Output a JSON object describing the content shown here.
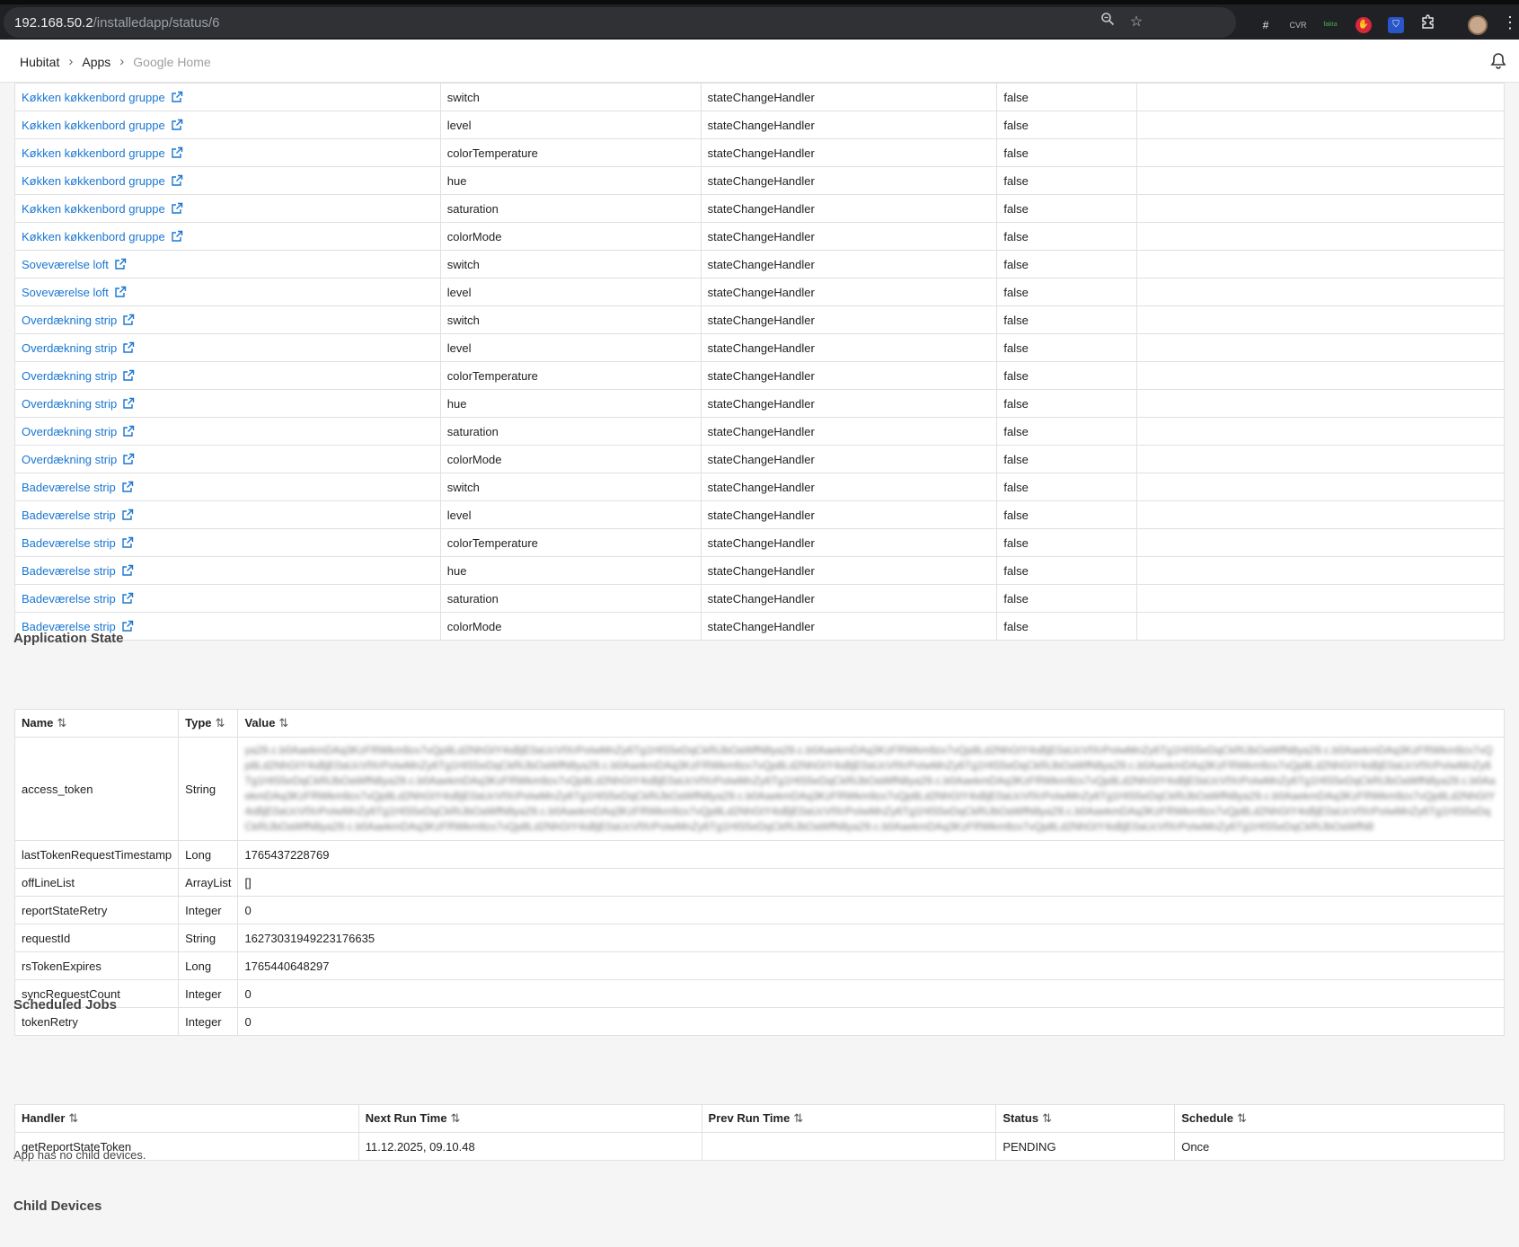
{
  "browser": {
    "url_host": "192.168.50.2",
    "url_path": "/installedapp/status/6",
    "extensions": [
      "#",
      "CVR",
      "fakta"
    ]
  },
  "breadcrumb": [
    "Hubitat",
    "Apps",
    "Google Home"
  ],
  "subscriptions": [
    {
      "device": "Køkken køkkenbord gruppe",
      "attribute": "switch",
      "handler": "stateChangeHandler",
      "filter": "false",
      "extra": ""
    },
    {
      "device": "Køkken køkkenbord gruppe",
      "attribute": "level",
      "handler": "stateChangeHandler",
      "filter": "false",
      "extra": ""
    },
    {
      "device": "Køkken køkkenbord gruppe",
      "attribute": "colorTemperature",
      "handler": "stateChangeHandler",
      "filter": "false",
      "extra": ""
    },
    {
      "device": "Køkken køkkenbord gruppe",
      "attribute": "hue",
      "handler": "stateChangeHandler",
      "filter": "false",
      "extra": ""
    },
    {
      "device": "Køkken køkkenbord gruppe",
      "attribute": "saturation",
      "handler": "stateChangeHandler",
      "filter": "false",
      "extra": ""
    },
    {
      "device": "Køkken køkkenbord gruppe",
      "attribute": "colorMode",
      "handler": "stateChangeHandler",
      "filter": "false",
      "extra": ""
    },
    {
      "device": "Soveværelse loft",
      "attribute": "switch",
      "handler": "stateChangeHandler",
      "filter": "false",
      "extra": ""
    },
    {
      "device": "Soveværelse loft",
      "attribute": "level",
      "handler": "stateChangeHandler",
      "filter": "false",
      "extra": ""
    },
    {
      "device": "Overdækning strip",
      "attribute": "switch",
      "handler": "stateChangeHandler",
      "filter": "false",
      "extra": ""
    },
    {
      "device": "Overdækning strip",
      "attribute": "level",
      "handler": "stateChangeHandler",
      "filter": "false",
      "extra": ""
    },
    {
      "device": "Overdækning strip",
      "attribute": "colorTemperature",
      "handler": "stateChangeHandler",
      "filter": "false",
      "extra": ""
    },
    {
      "device": "Overdækning strip",
      "attribute": "hue",
      "handler": "stateChangeHandler",
      "filter": "false",
      "extra": ""
    },
    {
      "device": "Overdækning strip",
      "attribute": "saturation",
      "handler": "stateChangeHandler",
      "filter": "false",
      "extra": ""
    },
    {
      "device": "Overdækning strip",
      "attribute": "colorMode",
      "handler": "stateChangeHandler",
      "filter": "false",
      "extra": ""
    },
    {
      "device": "Badeværelse strip",
      "attribute": "switch",
      "handler": "stateChangeHandler",
      "filter": "false",
      "extra": ""
    },
    {
      "device": "Badeværelse strip",
      "attribute": "level",
      "handler": "stateChangeHandler",
      "filter": "false",
      "extra": ""
    },
    {
      "device": "Badeværelse strip",
      "attribute": "colorTemperature",
      "handler": "stateChangeHandler",
      "filter": "false",
      "extra": ""
    },
    {
      "device": "Badeværelse strip",
      "attribute": "hue",
      "handler": "stateChangeHandler",
      "filter": "false",
      "extra": ""
    },
    {
      "device": "Badeværelse strip",
      "attribute": "saturation",
      "handler": "stateChangeHandler",
      "filter": "false",
      "extra": ""
    },
    {
      "device": "Badeværelse strip",
      "attribute": "colorMode",
      "handler": "stateChangeHandler",
      "filter": "false",
      "extra": ""
    }
  ],
  "app_state": {
    "title": "Application State",
    "headers": [
      "Name",
      "Type",
      "Value"
    ],
    "rows": [
      {
        "name": "access_token",
        "type": "String",
        "value": "",
        "blurred": true
      },
      {
        "name": "lastTokenRequestTimestamp",
        "type": "Long",
        "value": "1765437228769"
      },
      {
        "name": "offLineList",
        "type": "ArrayList",
        "value": "[]"
      },
      {
        "name": "reportStateRetry",
        "type": "Integer",
        "value": "0"
      },
      {
        "name": "requestId",
        "type": "String",
        "value": "16273031949223176635"
      },
      {
        "name": "rsTokenExpires",
        "type": "Long",
        "value": "1765440648297"
      },
      {
        "name": "syncRequestCount",
        "type": "Integer",
        "value": "0"
      },
      {
        "name": "tokenRetry",
        "type": "Integer",
        "value": "0"
      }
    ]
  },
  "scheduled_jobs": {
    "title": "Scheduled Jobs",
    "headers": [
      "Handler",
      "Next Run Time",
      "Prev Run Time",
      "Status",
      "Schedule"
    ],
    "rows": [
      {
        "handler": "getReportStateToken",
        "next": "11.12.2025, 09.10.48",
        "prev": "",
        "status": "PENDING",
        "schedule": "Once"
      }
    ]
  },
  "child_devices": {
    "title": "Child Devices",
    "empty_text": "App has no child devices."
  },
  "colors": {
    "link": "#1976d2",
    "chrome_bg": "#202124"
  },
  "icons": {
    "sort": "sort-icon",
    "external_link": "external-link-icon",
    "bell": "bell-icon"
  }
}
